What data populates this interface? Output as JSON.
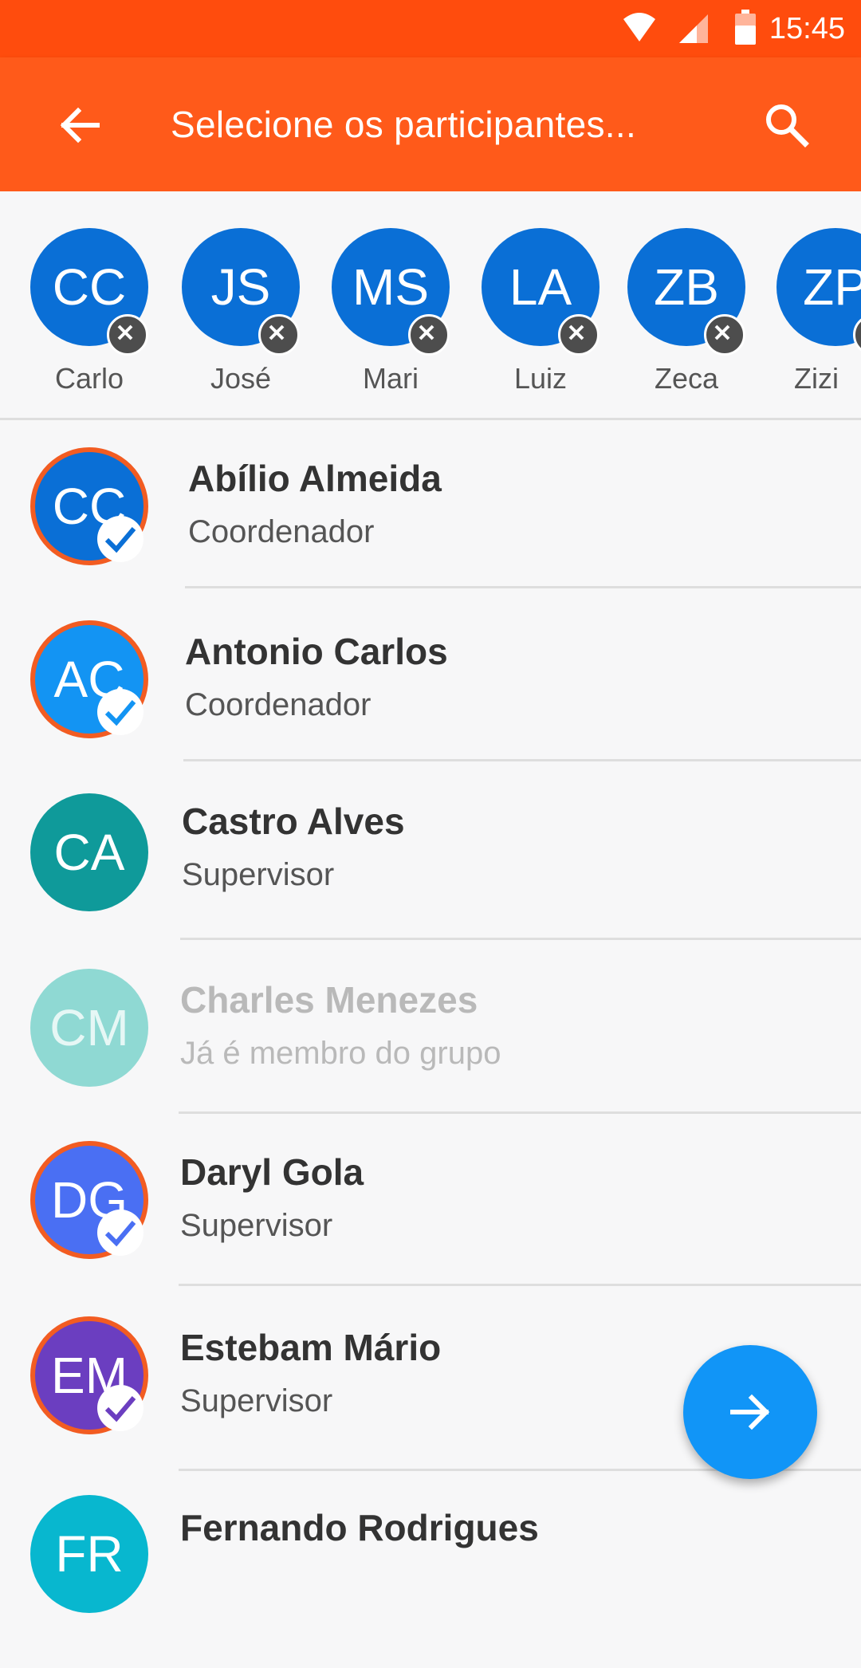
{
  "status_bar": {
    "time": "15:45"
  },
  "app_bar": {
    "title": "Selecione os participantes..."
  },
  "selected": [
    {
      "initials": "CC",
      "name": "Carlo"
    },
    {
      "initials": "JS",
      "name": "José"
    },
    {
      "initials": "MS",
      "name": "Mari"
    },
    {
      "initials": "LA",
      "name": "Luiz"
    },
    {
      "initials": "ZB",
      "name": "Zeca"
    },
    {
      "initials": "ZP",
      "name": "Zizi"
    }
  ],
  "contacts": [
    {
      "initials": "CC",
      "name": "Abílio Almeida",
      "role": "Coordenador",
      "color": "#0a6fd6",
      "selected": true
    },
    {
      "initials": "AC",
      "name": "Antonio Carlos",
      "role": "Coordenador",
      "color": "#1394f3",
      "selected": true
    },
    {
      "initials": "CA",
      "name": "Castro Alves",
      "role": "Supervisor",
      "color": "#0f9a9a",
      "selected": false
    },
    {
      "initials": "CM",
      "name": "Charles Menezes",
      "role": "Já é membro do grupo",
      "color": "#8fd9d3",
      "selected": false,
      "disabled": true
    },
    {
      "initials": "DG",
      "name": "Daryl Gola",
      "role": "Supervisor",
      "color": "#4a6ff3",
      "selected": true
    },
    {
      "initials": "EM",
      "name": "Estebam Mário",
      "role": "Supervisor",
      "color": "#6b3ec0",
      "selected": true
    },
    {
      "initials": "FR",
      "name": "Fernando Rodrigues",
      "role": "",
      "color": "#08b7cf",
      "selected": false
    }
  ],
  "colors": {
    "status_bar": "#ff4c0d",
    "app_bar": "#ff5a1a",
    "fab": "#1195f7",
    "selection_ring": "#f25c22"
  },
  "icons": {
    "back": "arrow-left-icon",
    "search": "search-icon",
    "remove": "close-icon",
    "check": "check-icon",
    "fab": "arrow-right-icon"
  }
}
